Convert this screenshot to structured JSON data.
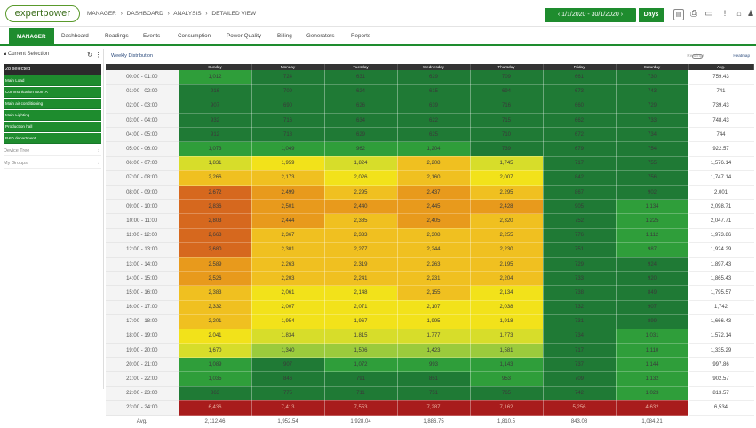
{
  "app": {
    "logo": "expertpower",
    "breadcrumbs": [
      "MANAGER",
      "›",
      "DASHBOARD",
      "›",
      "ANALYSIS",
      "›",
      "DETAILED VIEW"
    ],
    "date_range": "‹ 1/1/2020 - 30/1/2020 ›",
    "days_label": "Days",
    "toolbar_icons": [
      "pdf-icon",
      "print-icon",
      "monitor-icon",
      "info-icon",
      "home-icon",
      "user-icon"
    ]
  },
  "nav": {
    "tabs": [
      "MANAGER",
      "Dashboard",
      "Readings",
      "Events",
      "Consumption",
      "Power Quality",
      "Billing",
      "Generators",
      "Reports"
    ],
    "active": "MANAGER"
  },
  "sidebar": {
    "header": "Current Selection",
    "selected_count": "28 selected",
    "items": [
      "Main Load",
      "Communication room A",
      "Main air conditioning",
      "Main Lighting",
      "Production hall",
      "R&D department"
    ],
    "device_tree": "Device Tree",
    "my_groups": "My Groups"
  },
  "panel": {
    "title": "Weekly Distribution",
    "legend_left": "Readings",
    "legend_right": "Heatmap"
  },
  "colors": {
    "brand_green": "#1e8c2e",
    "dark_green": "#1f7a35",
    "green": "#2f9e3a",
    "light_green": "#9bcb3c",
    "yellow_green": "#d7dd2a",
    "yellow": "#f2e21a",
    "orange": "#e89a1c",
    "dark_orange": "#d6681e",
    "red": "#a81c1c"
  },
  "table": {
    "columns": [
      "",
      "Sunday",
      "Monday",
      "Tuesday",
      "Wednesday",
      "Thursday",
      "Friday",
      "Saturday",
      "Avg."
    ],
    "rows": [
      {
        "time": "00:00 - 01:00",
        "cells": [
          "1,012",
          "724",
          "631",
          "629",
          "709",
          "661",
          "730"
        ],
        "avg": "759.43"
      },
      {
        "time": "01:00 - 02:00",
        "cells": [
          "916",
          "709",
          "624",
          "615",
          "694",
          "673",
          "743"
        ],
        "avg": "741"
      },
      {
        "time": "02:00 - 03:00",
        "cells": [
          "907",
          "690",
          "626",
          "639",
          "716",
          "660",
          "729"
        ],
        "avg": "739.43"
      },
      {
        "time": "03:00 - 04:00",
        "cells": [
          "932",
          "716",
          "634",
          "622",
          "715",
          "662",
          "733"
        ],
        "avg": "748.43"
      },
      {
        "time": "04:00 - 05:00",
        "cells": [
          "912",
          "718",
          "629",
          "625",
          "710",
          "672",
          "734"
        ],
        "avg": "744"
      },
      {
        "time": "05:00 - 06:00",
        "cells": [
          "1,073",
          "1,049",
          "962",
          "1,204",
          "739",
          "679",
          "754"
        ],
        "avg": "922.57"
      },
      {
        "time": "06:00 - 07:00",
        "cells": [
          "1,831",
          "1,959",
          "1,824",
          "2,208",
          "1,745",
          "717",
          "755"
        ],
        "avg": "1,576.14"
      },
      {
        "time": "07:00 - 08:00",
        "cells": [
          "2,266",
          "2,173",
          "2,026",
          "2,160",
          "2,007",
          "842",
          "756"
        ],
        "avg": "1,747.14"
      },
      {
        "time": "08:00 - 09:00",
        "cells": [
          "2,672",
          "2,499",
          "2,295",
          "2,437",
          "2,295",
          "867",
          "902"
        ],
        "avg": "2,001"
      },
      {
        "time": "09:00 - 10:00",
        "cells": [
          "2,836",
          "2,501",
          "2,440",
          "2,445",
          "2,428",
          "905",
          "1,134"
        ],
        "avg": "2,098.71"
      },
      {
        "time": "10:00 - 11:00",
        "cells": [
          "2,803",
          "2,444",
          "2,385",
          "2,405",
          "2,320",
          "752",
          "1,225"
        ],
        "avg": "2,047.71"
      },
      {
        "time": "11:00 - 12:00",
        "cells": [
          "2,668",
          "2,367",
          "2,333",
          "2,308",
          "2,255",
          "776",
          "1,112"
        ],
        "avg": "1,973.86"
      },
      {
        "time": "12:00 - 13:00",
        "cells": [
          "2,680",
          "2,301",
          "2,277",
          "2,244",
          "2,230",
          "751",
          "987"
        ],
        "avg": "1,924.29"
      },
      {
        "time": "13:00 - 14:00",
        "cells": [
          "2,589",
          "2,263",
          "2,319",
          "2,263",
          "2,195",
          "729",
          "924"
        ],
        "avg": "1,897.43"
      },
      {
        "time": "14:00 - 15:00",
        "cells": [
          "2,526",
          "2,203",
          "2,241",
          "2,231",
          "2,204",
          "733",
          "920"
        ],
        "avg": "1,865.43"
      },
      {
        "time": "15:00 - 16:00",
        "cells": [
          "2,383",
          "2,061",
          "2,148",
          "2,155",
          "2,134",
          "738",
          "849"
        ],
        "avg": "1,795.57"
      },
      {
        "time": "16:00 - 17:00",
        "cells": [
          "2,332",
          "2,007",
          "2,071",
          "2,107",
          "2,038",
          "732",
          "907"
        ],
        "avg": "1,742"
      },
      {
        "time": "17:00 - 18:00",
        "cells": [
          "2,201",
          "1,954",
          "1,967",
          "1,995",
          "1,918",
          "731",
          "899"
        ],
        "avg": "1,666.43"
      },
      {
        "time": "18:00 - 19:00",
        "cells": [
          "2,041",
          "1,834",
          "1,815",
          "1,777",
          "1,773",
          "734",
          "1,031"
        ],
        "avg": "1,572.14"
      },
      {
        "time": "19:00 - 20:00",
        "cells": [
          "1,670",
          "1,340",
          "1,506",
          "1,423",
          "1,581",
          "717",
          "1,110"
        ],
        "avg": "1,335.29"
      },
      {
        "time": "20:00 - 21:00",
        "cells": [
          "1,089",
          "907",
          "1,072",
          "993",
          "1,143",
          "737",
          "1,144"
        ],
        "avg": "997.86"
      },
      {
        "time": "21:00 - 22:00",
        "cells": [
          "1,035",
          "846",
          "791",
          "851",
          "953",
          "709",
          "1,132"
        ],
        "avg": "902.57"
      },
      {
        "time": "22:00 - 23:00",
        "cells": [
          "863",
          "775",
          "711",
          "751",
          "765",
          "742",
          "1,023"
        ],
        "avg": "813.57"
      },
      {
        "time": "23:00 - 24:00",
        "cells": [
          "6,436",
          "7,413",
          "7,553",
          "7,287",
          "7,162",
          "5,256",
          "4,632"
        ],
        "avg": "6,534"
      }
    ],
    "avg_row": {
      "label": "Avg.",
      "cells": [
        "2,112.46",
        "1,952.54",
        "1,928.04",
        "1,886.75",
        "1,810.5",
        "843.08",
        "1,084.21"
      ],
      "avg": ""
    }
  }
}
